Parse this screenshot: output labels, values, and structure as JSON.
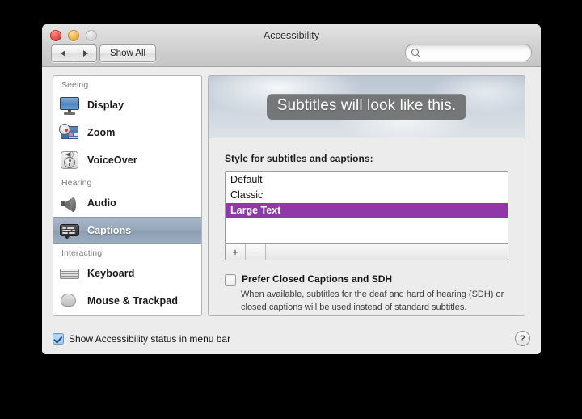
{
  "window": {
    "title": "Accessibility",
    "traffic_lights": [
      "close",
      "minimize",
      "zoom"
    ]
  },
  "toolbar": {
    "back_label": "◀",
    "forward_label": "▶",
    "show_all_label": "Show All",
    "search_placeholder": "",
    "search_value": ""
  },
  "sidebar": {
    "groups": [
      {
        "header": "Seeing",
        "items": [
          {
            "label": "Display",
            "icon": "display-icon",
            "selected": false
          },
          {
            "label": "Zoom",
            "icon": "zoom-icon",
            "selected": false
          },
          {
            "label": "VoiceOver",
            "icon": "voiceover-icon",
            "selected": false
          }
        ]
      },
      {
        "header": "Hearing",
        "items": [
          {
            "label": "Audio",
            "icon": "audio-icon",
            "selected": false
          },
          {
            "label": "Captions",
            "icon": "captions-icon",
            "selected": true
          }
        ]
      },
      {
        "header": "Interacting",
        "items": [
          {
            "label": "Keyboard",
            "icon": "keyboard-icon",
            "selected": false
          },
          {
            "label": "Mouse & Trackpad",
            "icon": "mouse-icon",
            "selected": false
          }
        ]
      }
    ]
  },
  "content": {
    "preview_caption": "Subtitles will look like this.",
    "style_label": "Style for subtitles and captions:",
    "styles": [
      {
        "name": "Default",
        "selected": false
      },
      {
        "name": "Classic",
        "selected": false
      },
      {
        "name": "Large Text",
        "selected": true
      }
    ],
    "list_toolbar": {
      "add_label": "+",
      "remove_label": "−"
    },
    "closed_captions": {
      "checkbox_label": "Prefer Closed Captions and SDH",
      "checked": false,
      "description": "When available, subtitles for the deaf and hard of hearing (SDH) or closed captions will be used instead of standard subtitles."
    }
  },
  "footer": {
    "status_checkbox_label": "Show Accessibility status in menu bar",
    "status_checked": true,
    "help_label": "?"
  },
  "colors": {
    "selection_purple": "#9138a8",
    "sidebar_selection": "#96a6bb",
    "caption_box": "#686868"
  }
}
